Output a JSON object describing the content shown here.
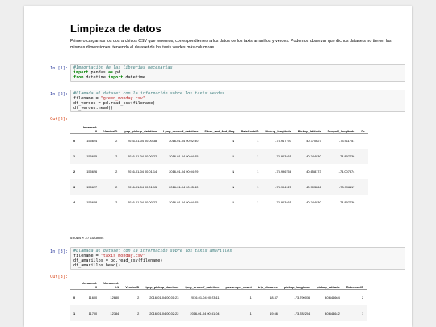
{
  "title": "Limpieza de datos",
  "intro": "Primero cargamos los dos archivos CSV que tenemos, correspondientes a los datos de los taxis amarillos y verdes. Podemos observar que dichos datasets no tienen las mismas dimensiones, teniendo el dataset de los taxis verdes más columnas.",
  "cells": {
    "c1": {
      "prompt": "In [1]:",
      "lines": [
        [
          {
            "t": "#Importación de las librerías necesarias",
            "c": "c"
          }
        ],
        [
          {
            "t": "import",
            "c": "k"
          },
          {
            "t": " pandas "
          },
          {
            "t": "as",
            "c": "k"
          },
          {
            "t": " pd"
          }
        ],
        [
          {
            "t": "from",
            "c": "k"
          },
          {
            "t": " datetime "
          },
          {
            "t": "import",
            "c": "k"
          },
          {
            "t": " datetime"
          }
        ]
      ]
    },
    "c2": {
      "prompt": "In [2]:",
      "lines": [
        [
          {
            "t": "#Llamada al dataset con la información sobre los taxis verdes",
            "c": "c"
          }
        ],
        [
          {
            "t": "filename = "
          },
          {
            "t": "\"green_monday.csv\"",
            "c": "s"
          }
        ],
        [
          {
            "t": "df_verdes = pd.read_csv(filename)"
          }
        ],
        [
          {
            "t": "df_verdes.head()"
          }
        ]
      ]
    },
    "c3": {
      "prompt": "In [3]:",
      "lines": [
        [
          {
            "t": "#Llamada al dataset con la información sobre los taxis amarillos",
            "c": "c"
          }
        ],
        [
          {
            "t": "filename = "
          },
          {
            "t": "\"taxis_monday.csv\"",
            "c": "s"
          }
        ],
        [
          {
            "t": "df_amarillos = pd.read_csv(filename)"
          }
        ],
        [
          {
            "t": "df_amarillos.head()"
          }
        ]
      ]
    }
  },
  "out2": {
    "prompt": "Out[2]:",
    "columns": [
      "",
      "Unnamed:\n0",
      "VendorID",
      "lpep_pickup_datetime",
      "Lpep_dropoff_datetime",
      "Store_and_fwd_flag",
      "RateCodeID",
      "Pickup_longitude",
      "Pickup_latitude",
      "Dropoff_longitude",
      "Dr"
    ],
    "rows": [
      [
        "0",
        "155624",
        "2",
        "2016-01-04 00:00:38",
        "2016-01-04 00:02:30",
        "N",
        "1",
        "-73.917793",
        "40.770627",
        "-73.911751",
        ""
      ],
      [
        "1",
        "155625",
        "2",
        "2016-01-04 00:00:22",
        "2016-01-04 00:04:45",
        "N",
        "1",
        "-73.903465",
        "40.744930",
        "-73.897736",
        ""
      ],
      [
        "2",
        "155626",
        "2",
        "2016-01-04 00:01:14",
        "2016-01-04 00:04:29",
        "N",
        "1",
        "-73.996758",
        "40.658173",
        "-74.007874",
        ""
      ],
      [
        "3",
        "155627",
        "2",
        "2016-01-04 00:01:15",
        "2016-01-04 00:05:40",
        "N",
        "1",
        "-73.994125",
        "40.703266",
        "-73.996117",
        ""
      ],
      [
        "4",
        "155628",
        "2",
        "2016-01-04 00:00:22",
        "2016-01-04 00:04:45",
        "N",
        "1",
        "-73.903465",
        "40.744930",
        "-73.897736",
        ""
      ]
    ],
    "footer": "5 rows × 27 columns"
  },
  "out3": {
    "prompt": "Out[3]:",
    "columns": [
      "",
      "Unnamed:\n0",
      "Unnamed:\n0.1",
      "VendorID",
      "tpep_pickup_datetime",
      "tpep_dropoff_datetime",
      "passenger_count",
      "trip_distance",
      "pickup_longitude",
      "pickup_latitude",
      "RatecodeID"
    ],
    "rows": [
      [
        "0",
        "11600",
        "12680",
        "2",
        "2016-01-04 00:01:23",
        "2016-01-04 00:23:11",
        "1",
        "18.37",
        "-73.790016",
        "40.646664",
        "2"
      ],
      [
        "1",
        "11700",
        "12784",
        "2",
        "2016-01-04 00:02:22",
        "2016-01-04 00:31:04",
        "1",
        "19.66",
        "-73.782204",
        "40.644642",
        "1"
      ]
    ]
  }
}
